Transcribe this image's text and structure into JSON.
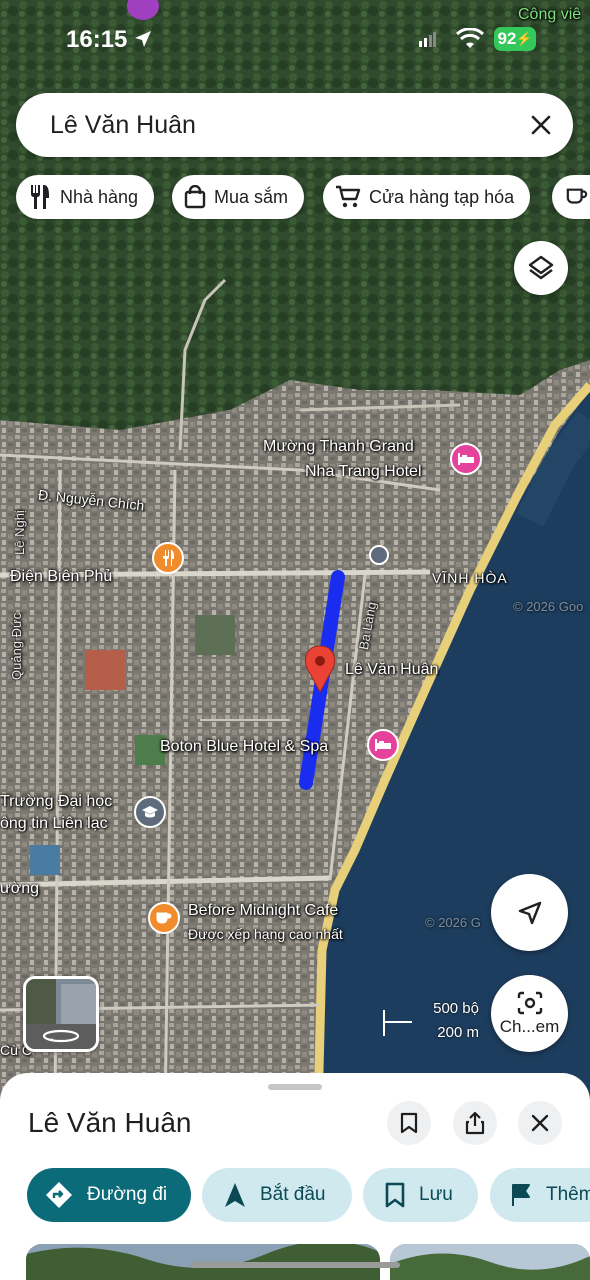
{
  "status_bar": {
    "time": "16:15",
    "battery": "92"
  },
  "search": {
    "value": "Lê Văn Huân"
  },
  "chips": [
    {
      "label": "Nhà hàng",
      "icon": "restaurant-icon"
    },
    {
      "label": "Mua sắm",
      "icon": "shopping-bag-icon"
    },
    {
      "label": "Cửa hàng tạp hóa",
      "icon": "cart-icon"
    }
  ],
  "map": {
    "labels": {
      "park": "Công viê",
      "muong_thanh_1": "Mường Thanh Grand",
      "muong_thanh_2": "Nha Trang Hotel",
      "nguyen_chich": "Đ. Nguyễn Chích",
      "le_nghi": "Lê Nghị",
      "dien_bien_phu": "Điện Biên Phủ",
      "vinh_hoa": "VĨNH HÒA",
      "quang_duc": "Quảng Đức",
      "ba_lang": "Ba Làng",
      "selected_street": "Lê Văn Huân",
      "boton": "Boton Blue Hotel & Spa",
      "university_1": "Trường Đại học",
      "university_2": "ông tin Liên lạc",
      "street_left": "ường",
      "cafe": "Before Midnight Cafe",
      "cafe_sub": "Được xếp hạng cao nhất",
      "cu_chi": "Cù C",
      "watermark_1": "© 2026 Goo",
      "watermark_2": "© 2026 G"
    },
    "scale": {
      "imperial": "500 bộ",
      "metric": "200 m"
    },
    "lens_label": "Ch...em"
  },
  "sheet": {
    "title": "Lê Văn Huân",
    "actions": [
      {
        "label": "Đường đi"
      },
      {
        "label": "Bắt đầu"
      },
      {
        "label": "Lưu"
      },
      {
        "label": "Thêm"
      }
    ]
  },
  "colors": {
    "route": "#1a2cf0",
    "pin": "#ea4335",
    "primary_button": "#0b6b78",
    "secondary_button": "#cfe9ef",
    "hotel_pin": "#e5439b",
    "food_pin": "#f08c2b"
  }
}
